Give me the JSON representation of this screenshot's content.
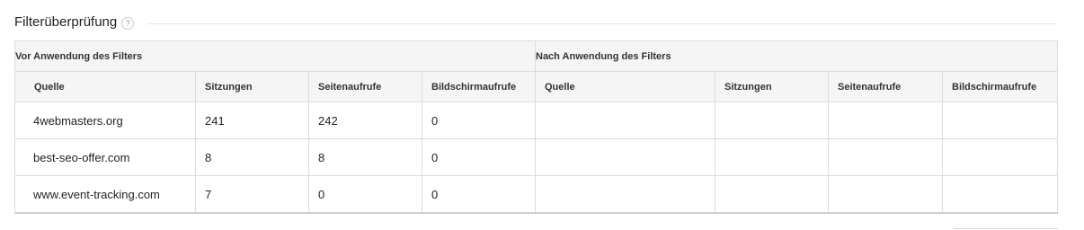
{
  "section": {
    "title": "Filterüberprüfung",
    "help_glyph": "?"
  },
  "groups": {
    "before": "Vor Anwendung des Filters",
    "after": "Nach Anwendung des Filters"
  },
  "columns": {
    "source": "Quelle",
    "sessions": "Sitzungen",
    "pageviews": "Seitenaufrufe",
    "screenviews": "Bildschirmaufrufe"
  },
  "rows": [
    {
      "source": "4webmasters.org",
      "sessions": "241",
      "pageviews": "242",
      "screenviews": "0"
    },
    {
      "source": "best-seo-offer.com",
      "sessions": "8",
      "pageviews": "8",
      "screenviews": "0"
    },
    {
      "source": "www.event-tracking.com",
      "sessions": "7",
      "pageviews": "0",
      "screenviews": "0"
    }
  ]
}
